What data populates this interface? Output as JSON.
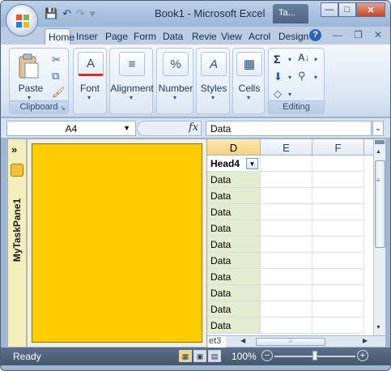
{
  "window": {
    "title": "Book1 - Microsoft Excel",
    "task_chip": "Ta...",
    "buttons": {
      "minimize": "—",
      "maximize": "□",
      "close": "✕"
    }
  },
  "quick_access": {
    "save": "💾",
    "undo": "↶",
    "redo": "↷",
    "more": "▾"
  },
  "ribbon_tabs": [
    "Home",
    "Inser",
    "Page",
    "Form",
    "Data",
    "Revie",
    "View",
    "Acrol",
    "Design"
  ],
  "ribbon_tab_extras": {
    "help": "?",
    "minimize": "—",
    "restore": "❐",
    "close": "✕"
  },
  "ribbon": {
    "clipboard": {
      "paste_label": "Paste",
      "group_label": "Clipboard"
    },
    "font": {
      "label": "Font",
      "icon": "A"
    },
    "alignment": {
      "label": "Alignment",
      "icon": "≡"
    },
    "number": {
      "label": "Number",
      "icon": "%"
    },
    "styles": {
      "label": "Styles",
      "icon": "A"
    },
    "cells": {
      "label": "Cells",
      "icon": "▦"
    },
    "editing": {
      "group_label": "Editing",
      "sum": "Σ",
      "sort": "A↓",
      "find": "🔭",
      "fill": "⬇",
      "clear": "◇"
    }
  },
  "formula_bar": {
    "name_box": "A4",
    "fx": "fx",
    "value": "Data"
  },
  "task_pane": {
    "title": "MyTaskPane1",
    "chevron": "»"
  },
  "grid": {
    "columns": [
      "D",
      "E",
      "F"
    ],
    "header_cell": "Head4",
    "data_cells": [
      "Data",
      "Data",
      "Data",
      "Data",
      "Data",
      "Data",
      "Data",
      "Data",
      "Data",
      "Data"
    ]
  },
  "sheet_tab": "et3",
  "status_bar": {
    "ready": "Ready",
    "zoom": "100%",
    "minus": "−",
    "plus": "+"
  },
  "colors": {
    "task_pane_panel": "#ffcc00",
    "task_pane_strip": "#f4eebc",
    "data_column": "#e3ecd1"
  }
}
